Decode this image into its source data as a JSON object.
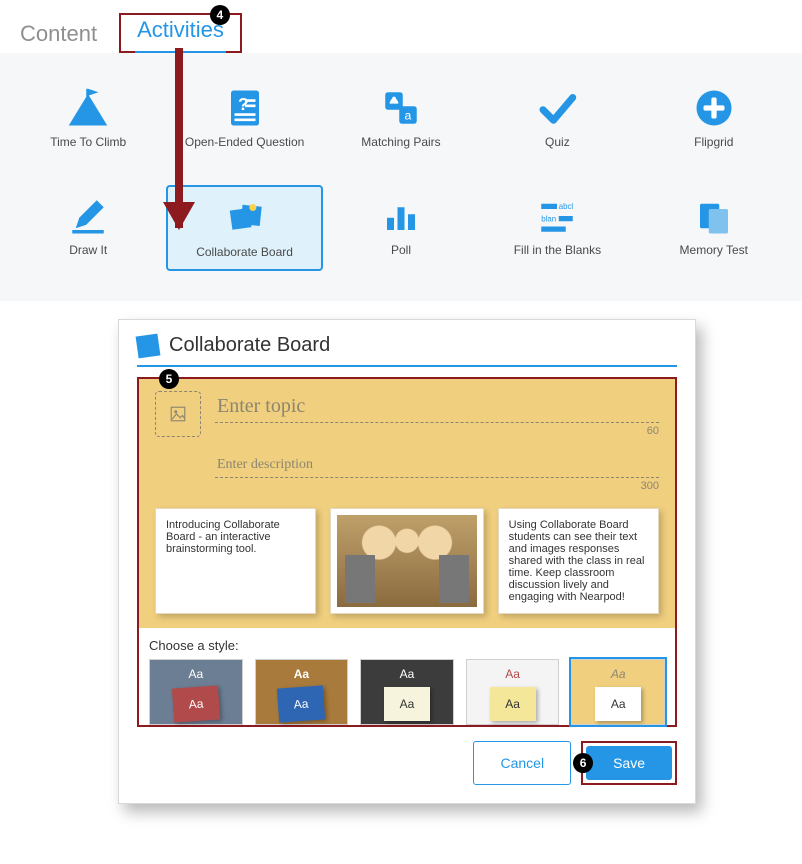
{
  "tabs": {
    "content": "Content",
    "activities": "Activities"
  },
  "steps": {
    "s4": "4",
    "s5": "5",
    "s6": "6"
  },
  "activities_list": {
    "time_to_climb": "Time To Climb",
    "open_ended": "Open-Ended Question",
    "matching_pairs": "Matching Pairs",
    "quiz": "Quiz",
    "flipgrid": "Flipgrid",
    "draw_it": "Draw It",
    "collaborate_board": "Collaborate Board",
    "poll": "Poll",
    "fill_blanks": "Fill in the Blanks",
    "memory_test": "Memory Test"
  },
  "modal": {
    "title": "Collaborate Board",
    "topic_placeholder": "Enter topic",
    "topic_max": "60",
    "desc_placeholder": "Enter description",
    "desc_max": "300",
    "card_intro": "Introducing Collaborate Board - an interactive brainstorming tool.",
    "card_detail": "Using Collaborate Board students can see their text and images responses shared with the class in real time. Keep classroom discussion lively and engaging with Nearpod!",
    "style_label": "Choose a style:",
    "style_sample": "Aa",
    "cancel": "Cancel",
    "save": "Save"
  }
}
